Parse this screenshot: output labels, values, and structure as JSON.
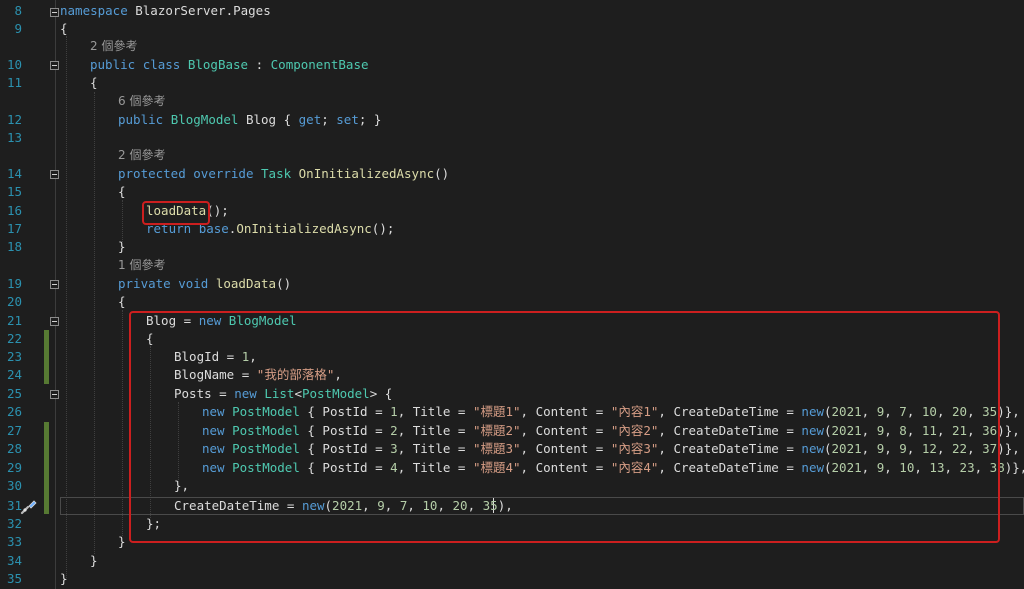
{
  "colors": {
    "background": "#1e1e1e",
    "line_number": "#2b91af",
    "keyword": "#569cd6",
    "type": "#4ec9b0",
    "string": "#d69d85",
    "method": "#dcdcaa",
    "number": "#b5cea8",
    "text": "#dcdcdc",
    "codelens": "#999999",
    "highlight_border": "#cc1f1f",
    "change_bar": "#577a33"
  },
  "icons": {
    "fold": "collapse-box-icon",
    "quick_actions": "screwdriver-brush-icon"
  },
  "line_numbers": [
    "8",
    "9",
    "10",
    "11",
    "12",
    "13",
    "14",
    "15",
    "16",
    "17",
    "18",
    "19",
    "20",
    "21",
    "22",
    "23",
    "24",
    "25",
    "26",
    "27",
    "28",
    "29",
    "30",
    "31",
    "32",
    "33",
    "34",
    "35"
  ],
  "codelens": {
    "blogbase": "2 個參考",
    "blog_property": "6 個參考",
    "on_initialized": "2 個參考",
    "load_data": "1 個參考"
  },
  "code": {
    "l8": [
      [
        "k",
        "namespace"
      ],
      [
        "p",
        " BlazorServer.Pages"
      ]
    ],
    "l9": [
      [
        "p",
        "{"
      ]
    ],
    "l10": [
      [
        "k",
        "public"
      ],
      [
        "p",
        " "
      ],
      [
        "k",
        "class"
      ],
      [
        "p",
        " "
      ],
      [
        "t",
        "BlogBase"
      ],
      [
        "p",
        " : "
      ],
      [
        "t",
        "ComponentBase"
      ]
    ],
    "l11": [
      [
        "p",
        "{"
      ]
    ],
    "l12": [
      [
        "k",
        "public"
      ],
      [
        "p",
        " "
      ],
      [
        "t",
        "BlogModel"
      ],
      [
        "p",
        " Blog { "
      ],
      [
        "k",
        "get"
      ],
      [
        "p",
        "; "
      ],
      [
        "k",
        "set"
      ],
      [
        "p",
        "; }"
      ]
    ],
    "l13": [],
    "l14": [
      [
        "k",
        "protected"
      ],
      [
        "p",
        " "
      ],
      [
        "k",
        "override"
      ],
      [
        "p",
        " "
      ],
      [
        "t",
        "Task"
      ],
      [
        "p",
        " "
      ],
      [
        "m",
        "OnInitializedAsync"
      ],
      [
        "p",
        "()"
      ]
    ],
    "l15": [
      [
        "p",
        "{"
      ]
    ],
    "l16": [
      [
        "m",
        "loadData"
      ],
      [
        "p",
        "();"
      ]
    ],
    "l17": [
      [
        "k",
        "return"
      ],
      [
        "p",
        " "
      ],
      [
        "k",
        "base"
      ],
      [
        "p",
        "."
      ],
      [
        "m",
        "OnInitializedAsync"
      ],
      [
        "p",
        "();"
      ]
    ],
    "l18": [
      [
        "p",
        "}"
      ]
    ],
    "l19": [
      [
        "k",
        "private"
      ],
      [
        "p",
        " "
      ],
      [
        "k",
        "void"
      ],
      [
        "p",
        " "
      ],
      [
        "m",
        "loadData"
      ],
      [
        "p",
        "()"
      ]
    ],
    "l20": [
      [
        "p",
        "{"
      ]
    ],
    "l21": [
      [
        "p",
        "Blog = "
      ],
      [
        "k",
        "new"
      ],
      [
        "p",
        " "
      ],
      [
        "t",
        "BlogModel"
      ]
    ],
    "l22": [
      [
        "p",
        "{"
      ]
    ],
    "l23": [
      [
        "p",
        "BlogId = "
      ],
      [
        "n",
        "1"
      ],
      [
        "p",
        ","
      ]
    ],
    "l24": [
      [
        "p",
        "BlogName = "
      ],
      [
        "s",
        "\"我的部落格\""
      ],
      [
        "p",
        ","
      ]
    ],
    "l25": [
      [
        "p",
        "Posts = "
      ],
      [
        "k",
        "new"
      ],
      [
        "p",
        " "
      ],
      [
        "t",
        "List"
      ],
      [
        "p",
        "<"
      ],
      [
        "t",
        "PostModel"
      ],
      [
        "p",
        "> {"
      ]
    ],
    "l26": [
      [
        "k",
        "new"
      ],
      [
        "p",
        " "
      ],
      [
        "t",
        "PostModel"
      ],
      [
        "p",
        " { PostId = "
      ],
      [
        "n",
        "1"
      ],
      [
        "p",
        ", Title = "
      ],
      [
        "s",
        "\"標題1\""
      ],
      [
        "p",
        ", Content = "
      ],
      [
        "s",
        "\"內容1\""
      ],
      [
        "p",
        ", CreateDateTime = "
      ],
      [
        "k",
        "new"
      ],
      [
        "p",
        "("
      ],
      [
        "n",
        "2021"
      ],
      [
        "p",
        ", "
      ],
      [
        "n",
        "9"
      ],
      [
        "p",
        ", "
      ],
      [
        "n",
        "7"
      ],
      [
        "p",
        ", "
      ],
      [
        "n",
        "10"
      ],
      [
        "p",
        ", "
      ],
      [
        "n",
        "20"
      ],
      [
        "p",
        ", "
      ],
      [
        "n",
        "35"
      ],
      [
        "p",
        ")},"
      ]
    ],
    "l27": [
      [
        "k",
        "new"
      ],
      [
        "p",
        " "
      ],
      [
        "t",
        "PostModel"
      ],
      [
        "p",
        " { PostId = "
      ],
      [
        "n",
        "2"
      ],
      [
        "p",
        ", Title = "
      ],
      [
        "s",
        "\"標題2\""
      ],
      [
        "p",
        ", Content = "
      ],
      [
        "s",
        "\"內容2\""
      ],
      [
        "p",
        ", CreateDateTime = "
      ],
      [
        "k",
        "new"
      ],
      [
        "p",
        "("
      ],
      [
        "n",
        "2021"
      ],
      [
        "p",
        ", "
      ],
      [
        "n",
        "9"
      ],
      [
        "p",
        ", "
      ],
      [
        "n",
        "8"
      ],
      [
        "p",
        ", "
      ],
      [
        "n",
        "11"
      ],
      [
        "p",
        ", "
      ],
      [
        "n",
        "21"
      ],
      [
        "p",
        ", "
      ],
      [
        "n",
        "36"
      ],
      [
        "p",
        ")},"
      ]
    ],
    "l28": [
      [
        "k",
        "new"
      ],
      [
        "p",
        " "
      ],
      [
        "t",
        "PostModel"
      ],
      [
        "p",
        " { PostId = "
      ],
      [
        "n",
        "3"
      ],
      [
        "p",
        ", Title = "
      ],
      [
        "s",
        "\"標題3\""
      ],
      [
        "p",
        ", Content = "
      ],
      [
        "s",
        "\"內容3\""
      ],
      [
        "p",
        ", CreateDateTime = "
      ],
      [
        "k",
        "new"
      ],
      [
        "p",
        "("
      ],
      [
        "n",
        "2021"
      ],
      [
        "p",
        ", "
      ],
      [
        "n",
        "9"
      ],
      [
        "p",
        ", "
      ],
      [
        "n",
        "9"
      ],
      [
        "p",
        ", "
      ],
      [
        "n",
        "12"
      ],
      [
        "p",
        ", "
      ],
      [
        "n",
        "22"
      ],
      [
        "p",
        ", "
      ],
      [
        "n",
        "37"
      ],
      [
        "p",
        ")},"
      ]
    ],
    "l29": [
      [
        "k",
        "new"
      ],
      [
        "p",
        " "
      ],
      [
        "t",
        "PostModel"
      ],
      [
        "p",
        " { PostId = "
      ],
      [
        "n",
        "4"
      ],
      [
        "p",
        ", Title = "
      ],
      [
        "s",
        "\"標題4\""
      ],
      [
        "p",
        ", Content = "
      ],
      [
        "s",
        "\"內容4\""
      ],
      [
        "p",
        ", CreateDateTime = "
      ],
      [
        "k",
        "new"
      ],
      [
        "p",
        "("
      ],
      [
        "n",
        "2021"
      ],
      [
        "p",
        ", "
      ],
      [
        "n",
        "9"
      ],
      [
        "p",
        ", "
      ],
      [
        "n",
        "10"
      ],
      [
        "p",
        ", "
      ],
      [
        "n",
        "13"
      ],
      [
        "p",
        ", "
      ],
      [
        "n",
        "23"
      ],
      [
        "p",
        ", "
      ],
      [
        "n",
        "38"
      ],
      [
        "p",
        ")},"
      ]
    ],
    "l30": [
      [
        "p",
        "},"
      ]
    ],
    "l31": [
      [
        "p",
        "CreateDateTime = "
      ],
      [
        "k",
        "new"
      ],
      [
        "p",
        "("
      ],
      [
        "n",
        "2021"
      ],
      [
        "p",
        ", "
      ],
      [
        "n",
        "9"
      ],
      [
        "p",
        ", "
      ],
      [
        "n",
        "7"
      ],
      [
        "p",
        ", "
      ],
      [
        "n",
        "10"
      ],
      [
        "p",
        ", "
      ],
      [
        "n",
        "20"
      ],
      [
        "p",
        ", "
      ],
      [
        "n",
        "35"
      ],
      [
        "p",
        "),"
      ]
    ],
    "l32": [
      [
        "p",
        "};"
      ]
    ],
    "l33": [
      [
        "p",
        "}"
      ]
    ],
    "l34": [
      [
        "p",
        "}"
      ]
    ],
    "l35": [
      [
        "p",
        "}"
      ]
    ]
  }
}
